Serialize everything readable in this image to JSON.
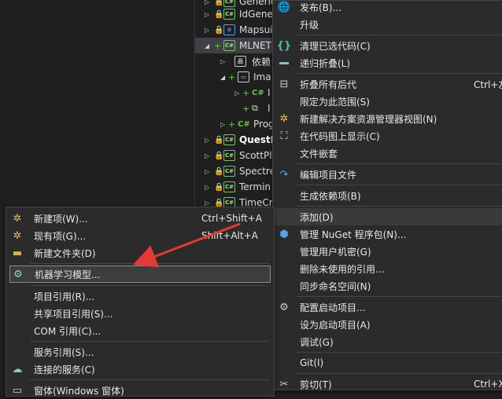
{
  "tree": {
    "items": [
      {
        "text": "Generic",
        "icon": "csharp-project-icon"
      },
      {
        "text": "IdGene",
        "icon": "csharp-project-icon"
      },
      {
        "text": "Mapsui",
        "icon": "web-project-icon"
      },
      {
        "text": "MLNET",
        "icon": "csharp-project-icon"
      },
      {
        "text": "依赖",
        "icon": "dependencies-icon"
      },
      {
        "text": "Ima",
        "icon": "folder-icon"
      },
      {
        "text": "I",
        "icon": "csharp-file-icon"
      },
      {
        "text": "I",
        "icon": "copy-file-icon"
      },
      {
        "text": "Prog",
        "icon": "csharp-file-icon"
      },
      {
        "text": "QuestP",
        "icon": "csharp-project-icon"
      },
      {
        "text": "ScottPl",
        "icon": "csharp-project-icon"
      },
      {
        "text": "Spectre",
        "icon": "csharp-project-icon"
      },
      {
        "text": "Termin",
        "icon": "csharp-project-icon"
      },
      {
        "text": "TimeCr",
        "icon": "csharp-project-icon"
      }
    ]
  },
  "main_menu": {
    "items": [
      {
        "label": "发布(B)...",
        "icon": "globe-icon",
        "shortcut": ""
      },
      {
        "label": "升级",
        "icon": "",
        "shortcut": ""
      },
      {
        "label": "清理已选代码(C)",
        "icon": "braces-icon",
        "shortcut": ""
      },
      {
        "label": "递归折叠(L)",
        "icon": "minus-icon",
        "shortcut": ""
      },
      {
        "label": "折叠所有后代",
        "icon": "collapse-icon",
        "shortcut": "Ctrl+左"
      },
      {
        "label": "限定为此范围(S)",
        "icon": "",
        "shortcut": ""
      },
      {
        "label": "新建解决方案资源管理器视图(N)",
        "icon": "new-view-icon",
        "shortcut": ""
      },
      {
        "label": "在代码图上显示(C)",
        "icon": "code-map-icon",
        "shortcut": ""
      },
      {
        "label": "文件嵌套",
        "icon": "",
        "shortcut": ""
      },
      {
        "label": "编辑项目文件",
        "icon": "edit-arrow-icon",
        "shortcut": ""
      },
      {
        "label": "生成依赖项(B)",
        "icon": "",
        "shortcut": ""
      },
      {
        "label": "添加(D)",
        "icon": "",
        "shortcut": ""
      },
      {
        "label": "管理 NuGet 程序包(N)...",
        "icon": "nuget-icon",
        "shortcut": ""
      },
      {
        "label": "管理用户机密(G)",
        "icon": "",
        "shortcut": ""
      },
      {
        "label": "删除未使用的引用...",
        "icon": "",
        "shortcut": ""
      },
      {
        "label": "同步命名空间(N)",
        "icon": "",
        "shortcut": ""
      },
      {
        "label": "配置启动项目...",
        "icon": "gear-icon",
        "shortcut": ""
      },
      {
        "label": "设为启动项目(A)",
        "icon": "",
        "shortcut": ""
      },
      {
        "label": "调试(G)",
        "icon": "",
        "shortcut": ""
      },
      {
        "label": "Git(I)",
        "icon": "",
        "shortcut": ""
      },
      {
        "label": "剪切(T)",
        "icon": "scissors-icon",
        "shortcut": "Ctrl+X"
      }
    ]
  },
  "sub_menu": {
    "items": [
      {
        "label": "新建项(W)...",
        "icon": "new-item-icon",
        "shortcut": "Ctrl+Shift+A"
      },
      {
        "label": "现有项(G)...",
        "icon": "existing-item-icon",
        "shortcut": "Shift+Alt+A"
      },
      {
        "label": "新建文件夹(D)",
        "icon": "folder-icon",
        "shortcut": ""
      },
      {
        "label": "机器学习模型...",
        "icon": "ml-gear-icon",
        "shortcut": ""
      },
      {
        "label": "项目引用(R)...",
        "icon": "",
        "shortcut": ""
      },
      {
        "label": "共享项目引用(S)...",
        "icon": "",
        "shortcut": ""
      },
      {
        "label": "COM 引用(C)...",
        "icon": "",
        "shortcut": ""
      },
      {
        "label": "服务引用(S)...",
        "icon": "",
        "shortcut": ""
      },
      {
        "label": "连接的服务(C)",
        "icon": "cloud-icon",
        "shortcut": ""
      },
      {
        "label": "窗体(Windows 窗体)",
        "icon": "form-icon",
        "shortcut": ""
      }
    ]
  },
  "colors": {
    "accent_arrow": "#e53935",
    "menu_bg": "#2b2b2b",
    "highlight": "#3a3a3a"
  }
}
